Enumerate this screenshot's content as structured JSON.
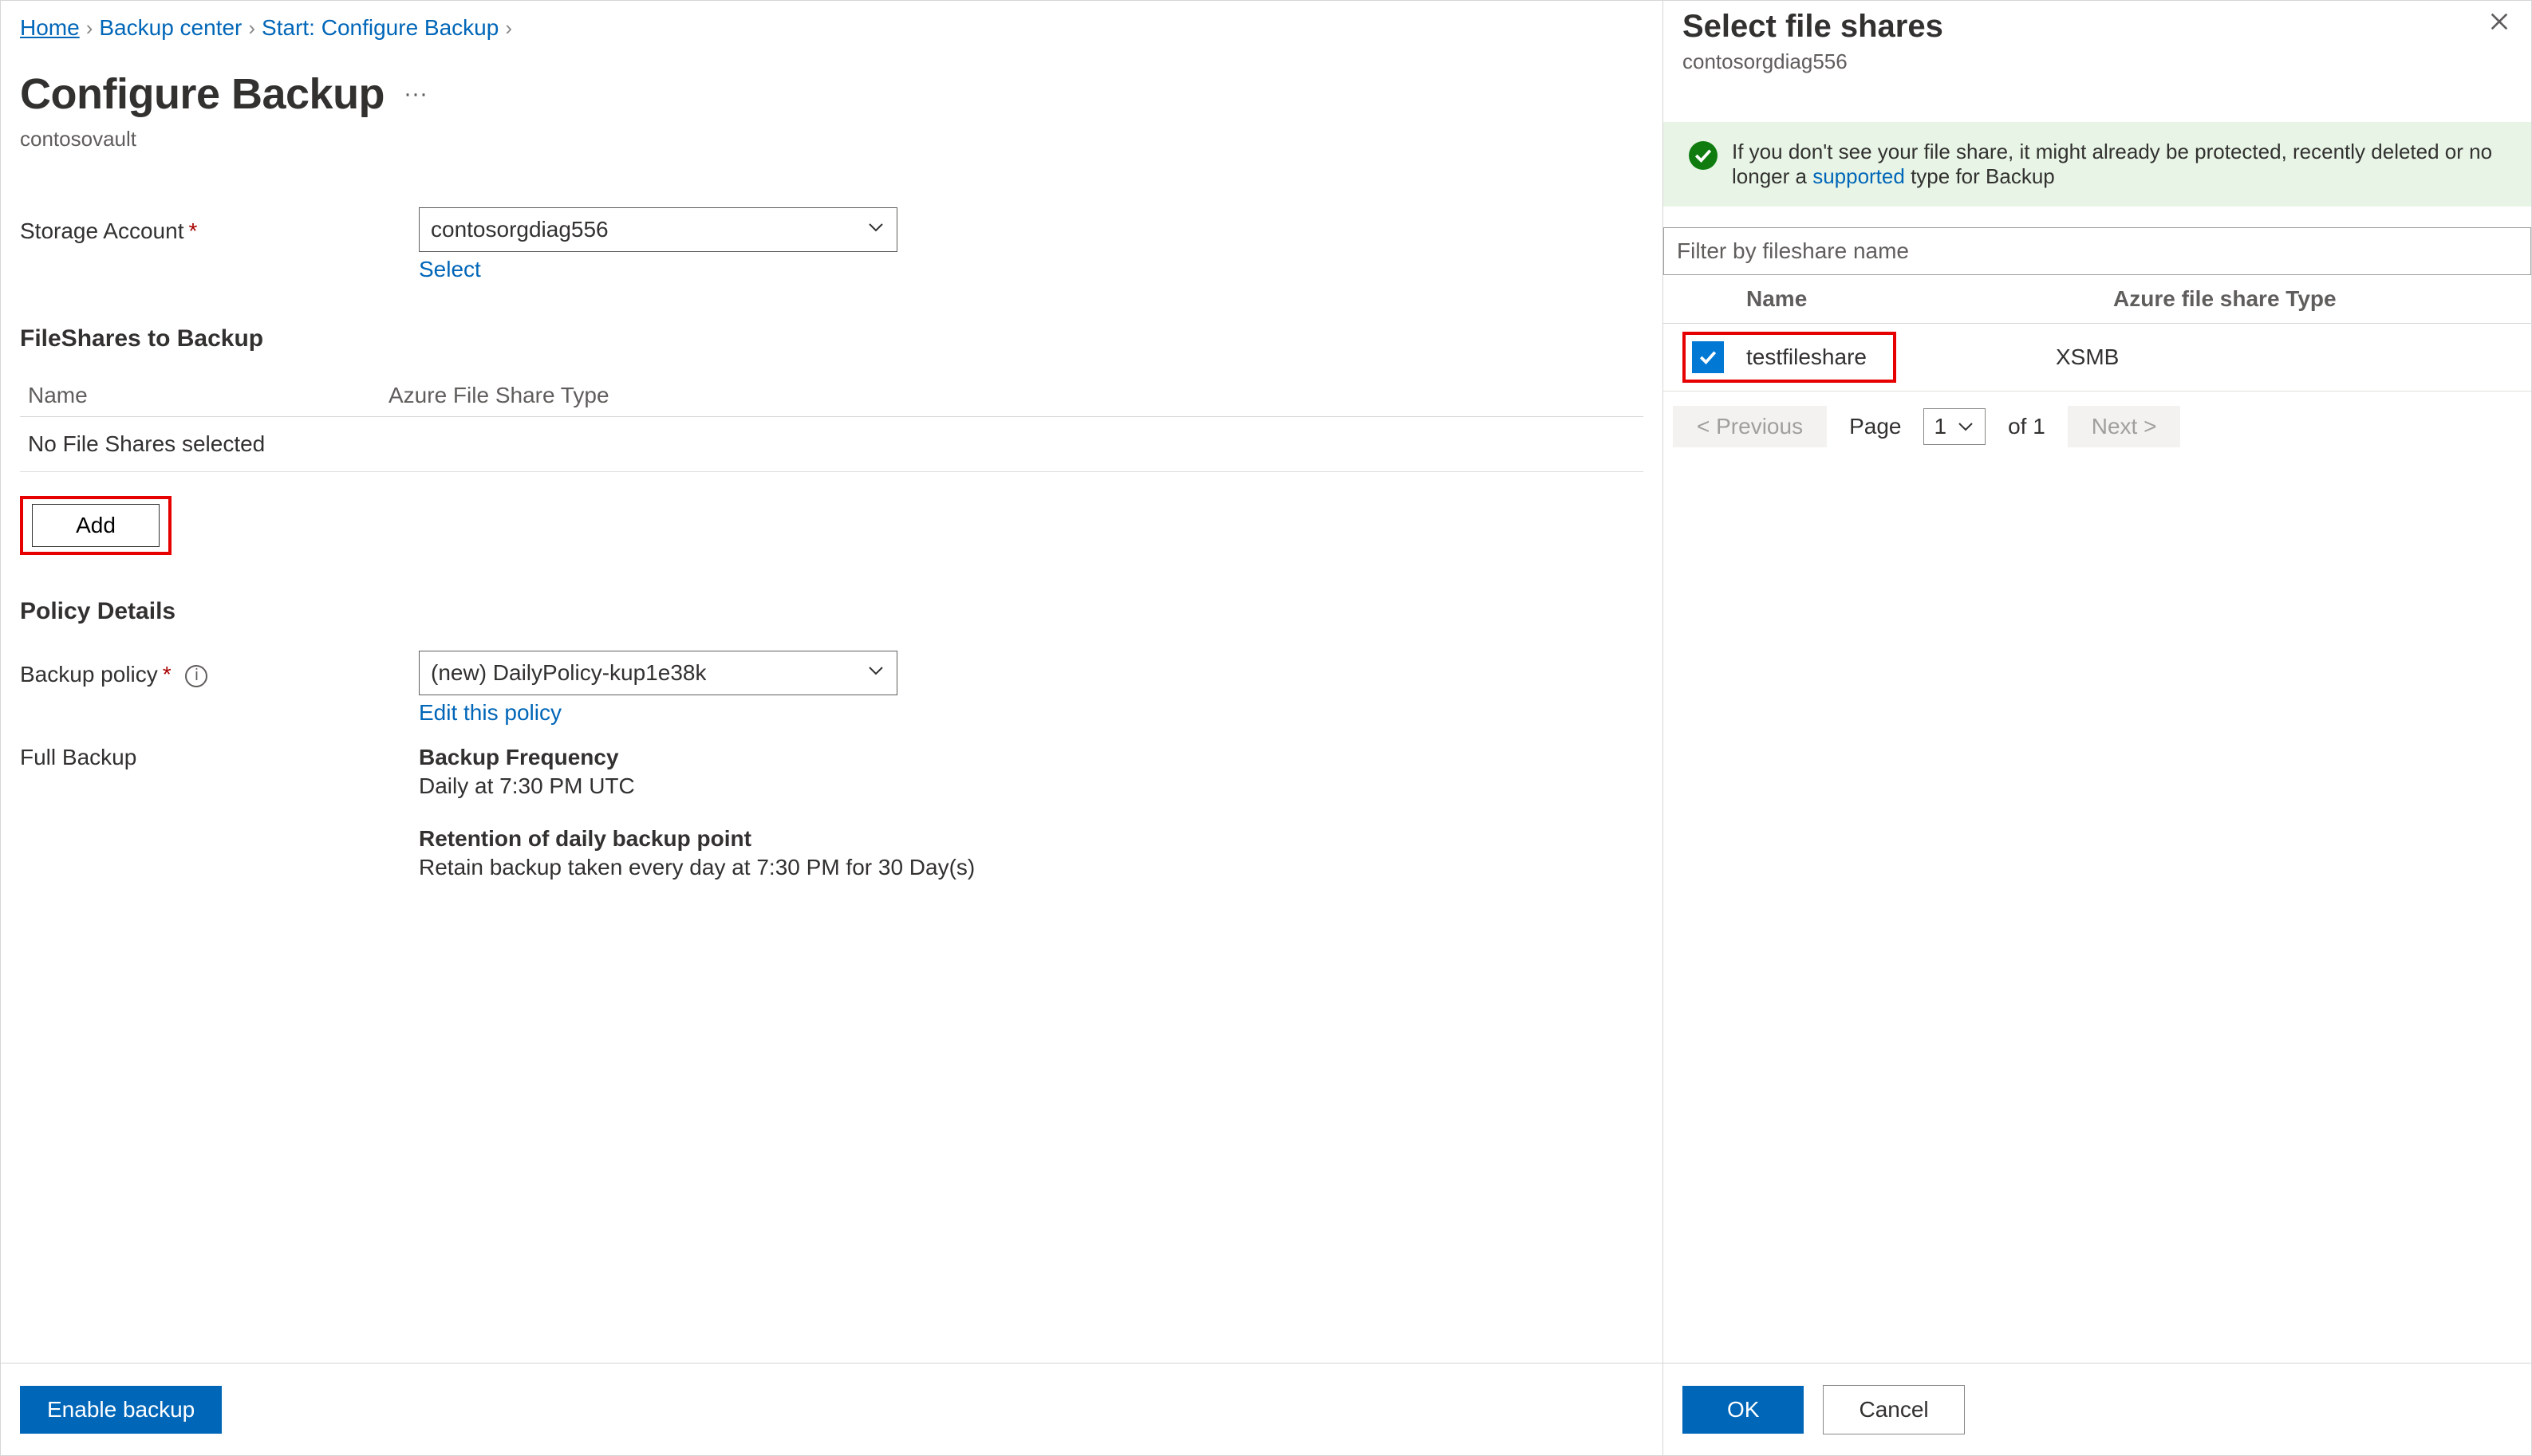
{
  "breadcrumb": {
    "home": "Home",
    "backup_center": "Backup center",
    "start": "Start: Configure Backup"
  },
  "page": {
    "title": "Configure Backup",
    "subtitle": "contosovault"
  },
  "storage_account": {
    "label": "Storage Account",
    "value": "contosorgdiag556",
    "select_link": "Select"
  },
  "fileshares": {
    "heading": "FileShares to Backup",
    "col_name": "Name",
    "col_type": "Azure File Share Type",
    "empty_msg": "No File Shares selected",
    "add_btn": "Add"
  },
  "policy": {
    "heading": "Policy Details",
    "backup_policy_label": "Backup policy",
    "backup_policy_value": "(new) DailyPolicy-kup1e38k",
    "edit_link": "Edit this policy",
    "full_backup_label": "Full Backup",
    "freq_title": "Backup Frequency",
    "freq_text": "Daily at 7:30 PM UTC",
    "ret_title": "Retention of daily backup point",
    "ret_text": "Retain backup taken every day at 7:30 PM for 30 Day(s)"
  },
  "footer": {
    "enable": "Enable backup"
  },
  "side": {
    "title": "Select file shares",
    "subtitle": "contosorgdiag556",
    "info_pre": "If you don't see your file share, it might already be protected, recently deleted or no longer a ",
    "info_link": "supported",
    "info_post": " type for Backup",
    "filter_ph": "Filter by fileshare name",
    "col_name": "Name",
    "col_type": "Azure file share Type",
    "row_name": "testfileshare",
    "row_type": "XSMB",
    "prev": "<  Previous",
    "page_label": "Page",
    "page_val": "1",
    "page_of": "of 1",
    "next": "Next  >",
    "ok": "OK",
    "cancel": "Cancel"
  }
}
